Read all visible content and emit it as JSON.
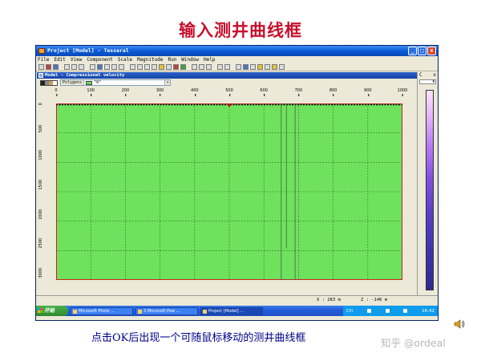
{
  "slide": {
    "title": "输入测井曲线框",
    "caption": "点击OK后出现一个可随鼠标移动的测井曲线框",
    "watermark": "知乎 @ordeal"
  },
  "window": {
    "title": "Project [Model] - Tesseral",
    "controls": [
      "_",
      "□",
      "x"
    ],
    "menu": [
      "File",
      "Edit",
      "View",
      "Component",
      "Scale",
      "Magnitude",
      "Run",
      "Window",
      "Help"
    ]
  },
  "child": {
    "title": "Model - Compressional velocity",
    "polygons_label": "Polygons",
    "polygon_value": "\"0\"",
    "arrow": "▾"
  },
  "side_panel": {
    "c_label": "C",
    "x_label": "x",
    "arrow": "▾"
  },
  "ruler": {
    "x_ticks": [
      "0",
      "100",
      "200",
      "300",
      "400",
      "500",
      "600",
      "700",
      "800",
      "900",
      "1000"
    ],
    "y_ticks": [
      "0",
      "500",
      "1000",
      "1500",
      "2000",
      "2500",
      "3000"
    ]
  },
  "model": {
    "fill_color": "#6ee25c",
    "grid_color": "#2a4a2a",
    "boundary_color": "#d02020",
    "x_range": [
      0,
      1000
    ],
    "y_range": [
      0,
      3000
    ],
    "well_box_x": [
      650,
      690
    ],
    "well_line_x": 665,
    "marker_x": 500
  },
  "status": {
    "x": "X : 283 m",
    "z": "Z : -146 m"
  },
  "taskbar": {
    "start": "开始",
    "tasks": [
      "Microsoft Photo ...",
      "3 Microsoft Pow ...",
      "Project [Model] ..."
    ],
    "tray_lang": "CH",
    "clock": "16:42"
  },
  "colors": {
    "title": "#c8102e",
    "caption": "#00008b",
    "titlebar": "#0a5ad8"
  }
}
